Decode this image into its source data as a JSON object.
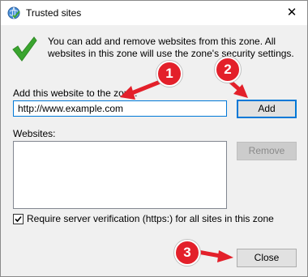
{
  "window": {
    "title": "Trusted sites",
    "close_glyph": "✕"
  },
  "info": {
    "text": "You can add and remove websites from this zone. All websites in this zone will use the zone's security settings."
  },
  "add": {
    "label": "Add this website to the zone:",
    "value": "http://www.example.com",
    "button": "Add"
  },
  "websites": {
    "label": "Websites:",
    "items": [],
    "remove_button": "Remove"
  },
  "verification": {
    "label": "Require server verification (https:) for all sites in this zone",
    "checked": true
  },
  "close_button": "Close",
  "markers": [
    "1",
    "2",
    "3"
  ],
  "colors": {
    "marker": "#e3202a",
    "focus": "#0078d7",
    "check": "#3aa52f"
  },
  "icons": {
    "title": "globe-check-icon",
    "zone": "green-checkmark-icon",
    "markers": "red-arrow-icon"
  }
}
